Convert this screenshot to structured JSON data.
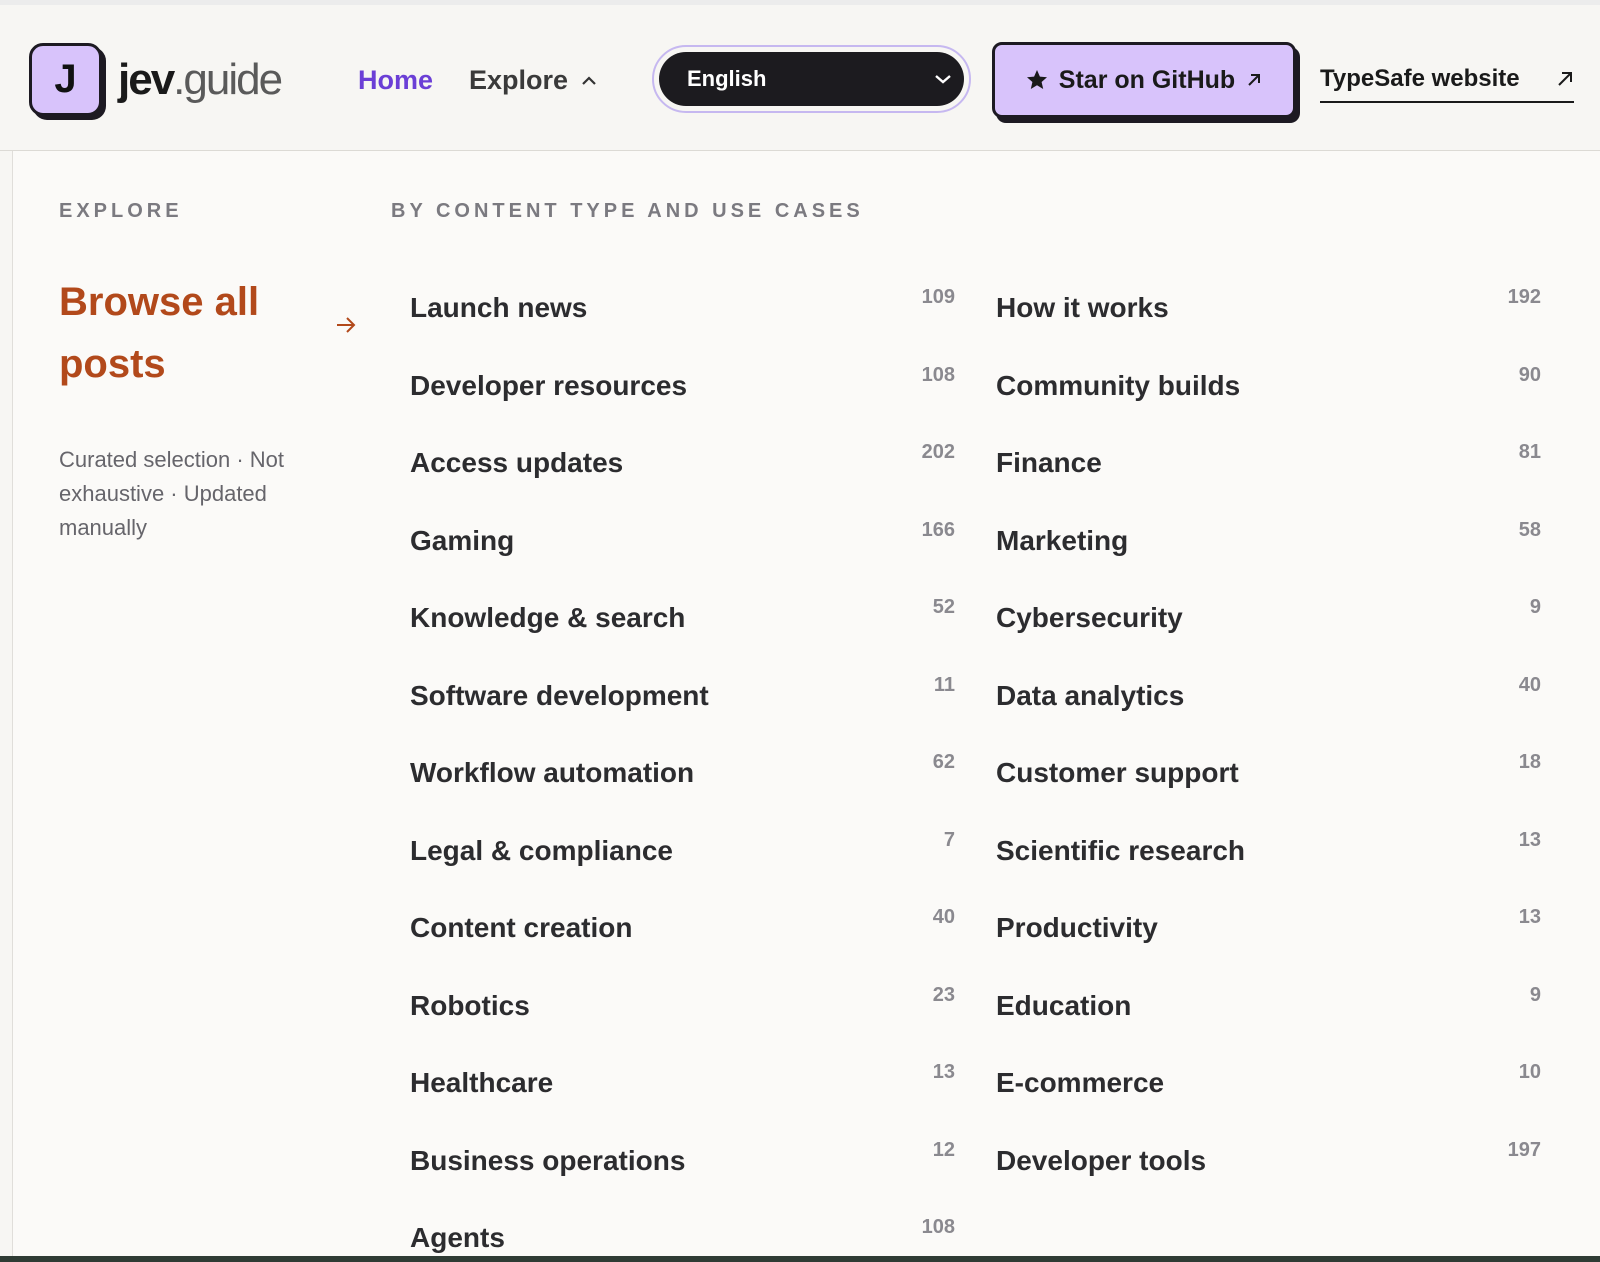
{
  "header": {
    "logo_letter": "J",
    "logo_name_main": "jev",
    "logo_name_rest": ".guide",
    "nav": {
      "home": "Home",
      "explore": "Explore"
    },
    "language": {
      "selected": "English"
    },
    "github_button": "Star on GitHub",
    "website_link": "TypeSafe website"
  },
  "panel": {
    "eyebrow_left": "EXPLORE",
    "eyebrow_right": "BY CONTENT TYPE AND USE CASES",
    "browse_all": "Browse all posts",
    "note": "Curated selection · Not exhaustive · Updated manually",
    "left_column": [
      {
        "label": "Launch news",
        "count": "109"
      },
      {
        "label": "Developer resources",
        "count": "108"
      },
      {
        "label": "Access updates",
        "count": "202"
      },
      {
        "label": "Gaming",
        "count": "166"
      },
      {
        "label": "Knowledge & search",
        "count": "52"
      },
      {
        "label": "Software development",
        "count": "11"
      },
      {
        "label": "Workflow automation",
        "count": "62"
      },
      {
        "label": "Legal & compliance",
        "count": "7"
      },
      {
        "label": "Content creation",
        "count": "40"
      },
      {
        "label": "Robotics",
        "count": "23"
      },
      {
        "label": "Healthcare",
        "count": "13"
      },
      {
        "label": "Business operations",
        "count": "12"
      },
      {
        "label": "Agents",
        "count": "108"
      }
    ],
    "right_column": [
      {
        "label": "How it works",
        "count": "192"
      },
      {
        "label": "Community builds",
        "count": "90"
      },
      {
        "label": "Finance",
        "count": "81"
      },
      {
        "label": "Marketing",
        "count": "58"
      },
      {
        "label": "Cybersecurity",
        "count": "9"
      },
      {
        "label": "Data analytics",
        "count": "40"
      },
      {
        "label": "Customer support",
        "count": "18"
      },
      {
        "label": "Scientific research",
        "count": "13"
      },
      {
        "label": "Productivity",
        "count": "13"
      },
      {
        "label": "Education",
        "count": "9"
      },
      {
        "label": "E-commerce",
        "count": "10"
      },
      {
        "label": "Developer tools",
        "count": "197"
      }
    ]
  },
  "colors": {
    "accent_purple": "#6b3fd6",
    "lavender": "#d8c3fb",
    "browse_orange": "#b2491b"
  }
}
